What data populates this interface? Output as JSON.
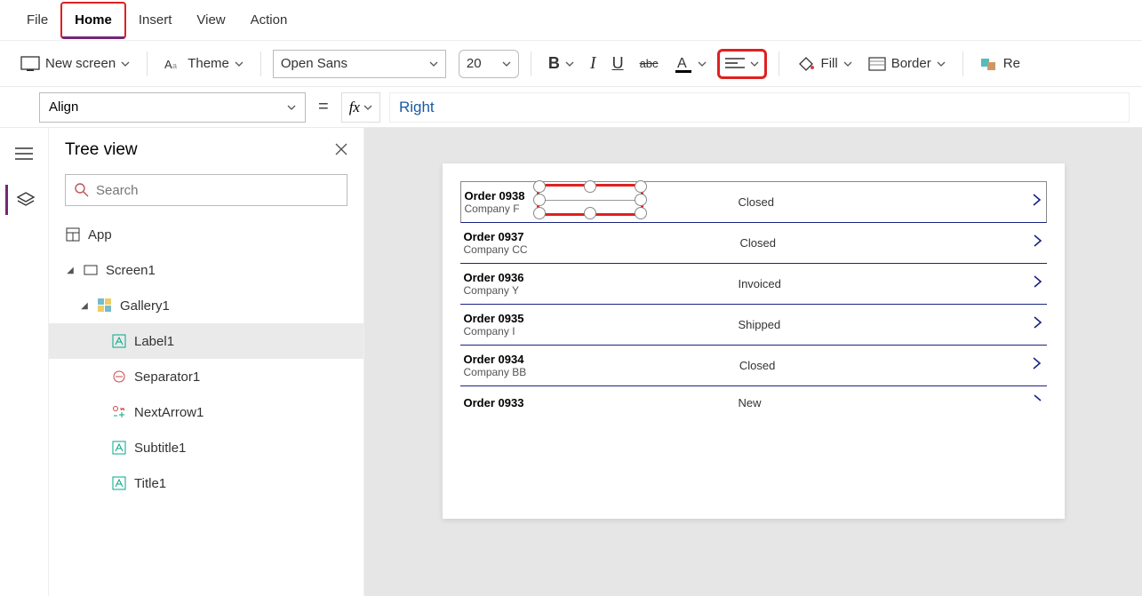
{
  "menu": {
    "file": "File",
    "home": "Home",
    "insert": "Insert",
    "view": "View",
    "action": "Action"
  },
  "ribbon": {
    "new_screen": "New screen",
    "theme": "Theme",
    "font_name": "Open Sans",
    "font_size": "20",
    "bold": "B",
    "fill": "Fill",
    "border": "Border",
    "reorder": "Re"
  },
  "formula": {
    "property": "Align",
    "fx": "fx",
    "value": "Right"
  },
  "tree": {
    "title": "Tree view",
    "search_placeholder": "Search",
    "app": "App",
    "screen": "Screen1",
    "gallery": "Gallery1",
    "items": [
      "Label1",
      "Separator1",
      "NextArrow1",
      "Subtitle1",
      "Title1"
    ]
  },
  "gallery_data": [
    {
      "title": "Order 0938",
      "sub": "Company F",
      "status": "Closed"
    },
    {
      "title": "Order 0937",
      "sub": "Company CC",
      "status": "Closed"
    },
    {
      "title": "Order 0936",
      "sub": "Company Y",
      "status": "Invoiced"
    },
    {
      "title": "Order 0935",
      "sub": "Company I",
      "status": "Shipped"
    },
    {
      "title": "Order 0934",
      "sub": "Company BB",
      "status": "Closed"
    },
    {
      "title": "Order 0933",
      "sub": "",
      "status": "New"
    }
  ]
}
